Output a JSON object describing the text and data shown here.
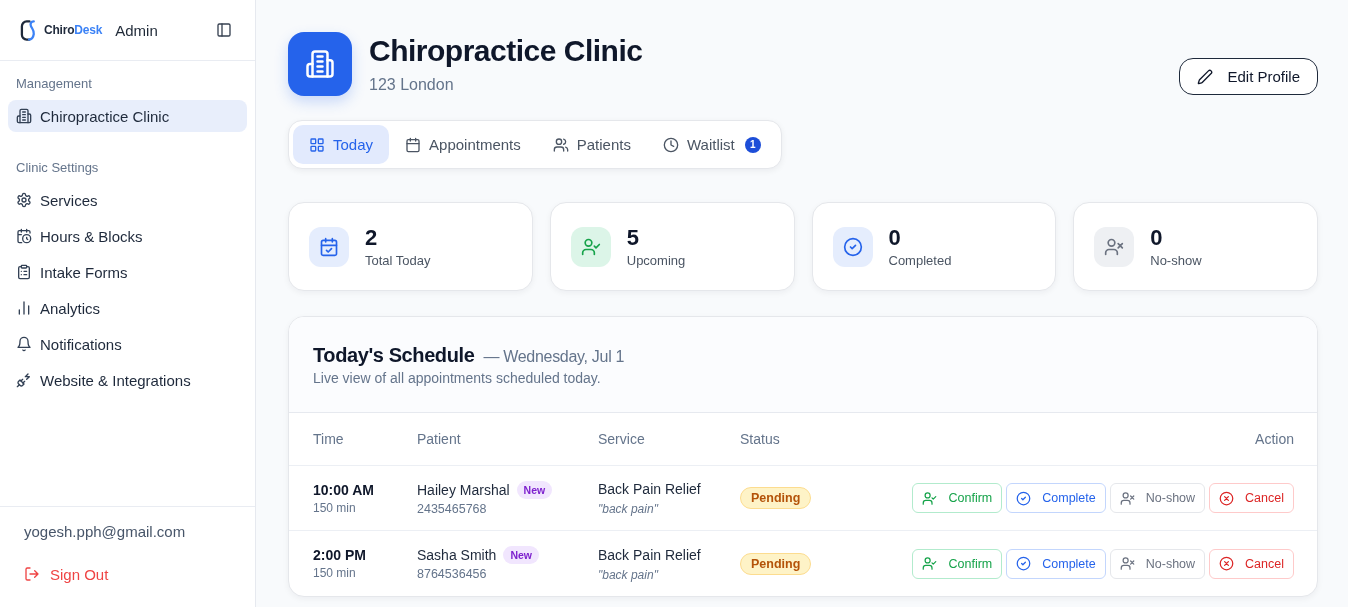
{
  "sidebar": {
    "brand": {
      "first": "Chiro",
      "second": "Desk"
    },
    "role": "Admin",
    "sections": [
      {
        "heading": "Management",
        "items": [
          {
            "label": "Chiropractice Clinic",
            "selected": true
          }
        ]
      },
      {
        "heading": "Clinic Settings",
        "items": [
          {
            "label": "Services",
            "selected": false
          },
          {
            "label": "Hours & Blocks",
            "selected": false
          },
          {
            "label": "Intake Forms",
            "selected": false
          },
          {
            "label": "Analytics",
            "selected": false
          },
          {
            "label": "Notifications",
            "selected": false
          },
          {
            "label": "Website & Integrations",
            "selected": false
          }
        ]
      }
    ],
    "user_email": "yogesh.pph@gmail.com",
    "sign_out": "Sign Out"
  },
  "clinic": {
    "name": "Chiropractice Clinic",
    "address": "123 London",
    "edit_button": "Edit Profile"
  },
  "tabs": [
    {
      "label": "Today",
      "selected": true
    },
    {
      "label": "Appointments",
      "selected": false
    },
    {
      "label": "Patients",
      "selected": false
    },
    {
      "label": "Waitlist",
      "selected": false,
      "badge": "1"
    }
  ],
  "stats": [
    {
      "value": "2",
      "label": "Total Today"
    },
    {
      "value": "5",
      "label": "Upcoming"
    },
    {
      "value": "0",
      "label": "Completed"
    },
    {
      "value": "0",
      "label": "No-show"
    }
  ],
  "schedule": {
    "title": "Today's Schedule",
    "date": "— Wednesday, Jul 1",
    "subtitle": "Live view of all appointments scheduled today.",
    "columns": [
      "Time",
      "Patient",
      "Service",
      "Status",
      "Action"
    ],
    "rows": [
      {
        "time": "10:00 AM",
        "duration": "150 min",
        "patient": "Hailey Marshal",
        "tag": "New",
        "phone": "2435465768",
        "service": "Back Pain Relief",
        "note": "\"back pain\"",
        "status": {
          "label": "Pending",
          "kind": "pending"
        },
        "actions": [
          {
            "label": "Confirm",
            "kind": "confirm"
          },
          {
            "label": "Complete",
            "kind": "complete"
          },
          {
            "label": "No-show",
            "kind": "no_show"
          },
          {
            "label": "Cancel",
            "kind": "cancel"
          }
        ]
      },
      {
        "time": "2:00 PM",
        "duration": "150 min",
        "patient": "Sasha Smith",
        "tag": "New",
        "phone": "8764536456",
        "service": "Back Pain Relief",
        "note": "\"back pain\"",
        "status": {
          "label": "Pending",
          "kind": "pending"
        },
        "actions": [
          {
            "label": "Confirm",
            "kind": "confirm"
          },
          {
            "label": "Complete",
            "kind": "complete"
          },
          {
            "label": "No-show",
            "kind": "no_show"
          },
          {
            "label": "Cancel",
            "kind": "cancel"
          }
        ]
      }
    ]
  }
}
